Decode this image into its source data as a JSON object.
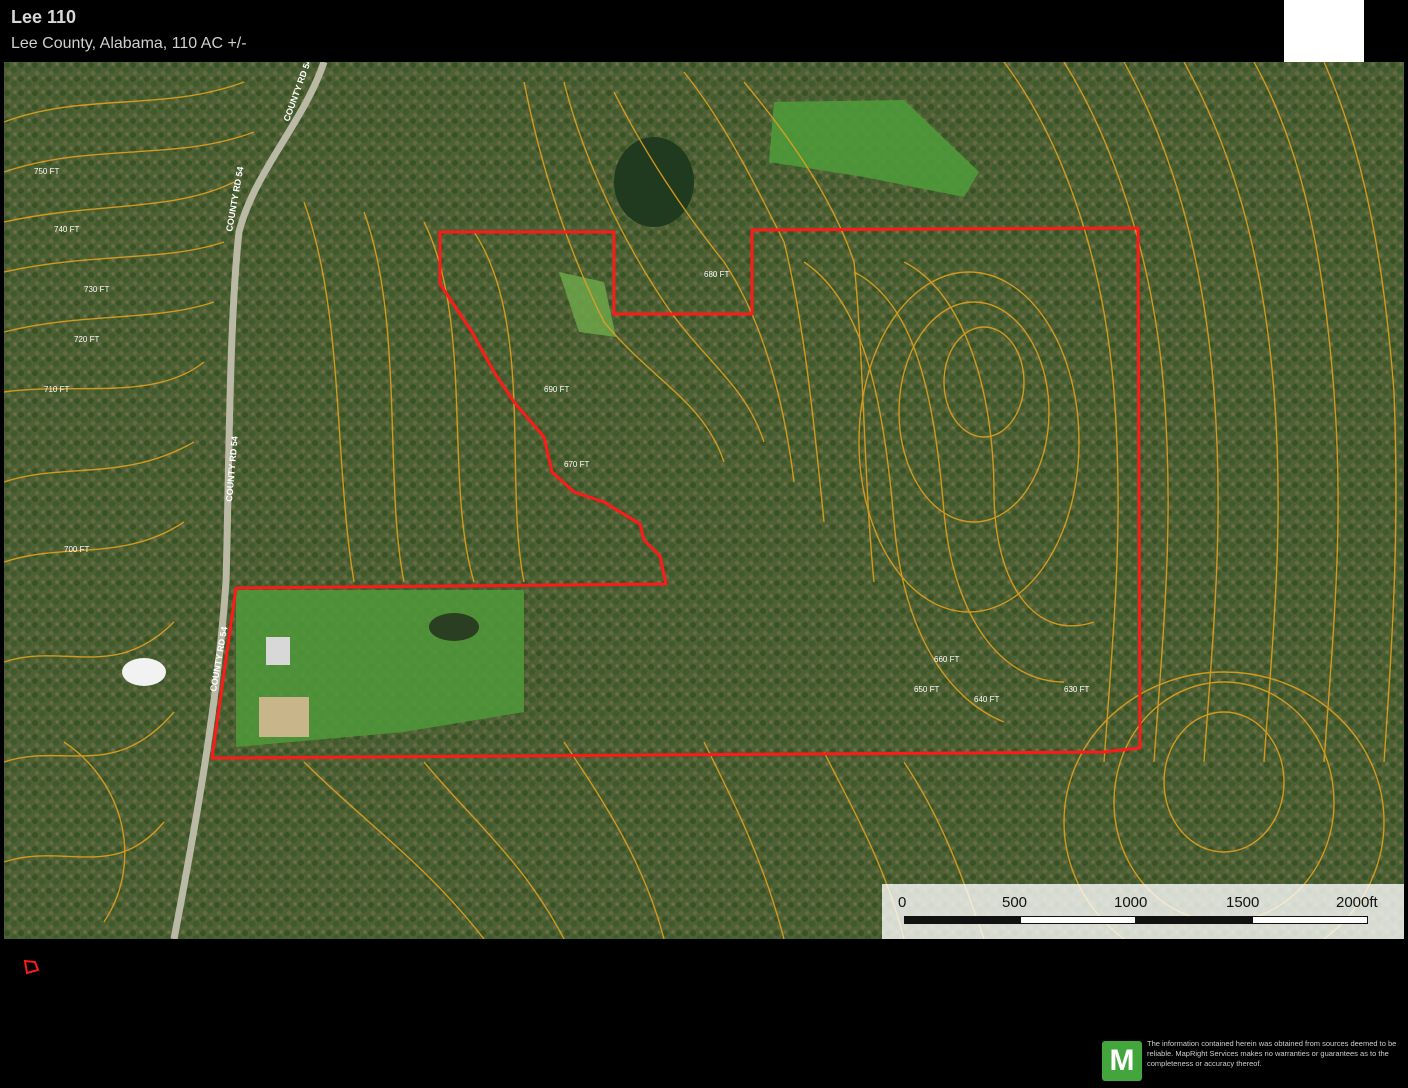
{
  "header": {
    "title": "Lee 110",
    "subtitle": "Lee County, Alabama, 110 AC +/-"
  },
  "map": {
    "road_labels": [
      "COUNTY RD 54",
      "COUNTY RD 54",
      "COUNTY RD 54",
      "COUNTY RD 54"
    ],
    "contour_labels": [
      "750 FT",
      "740 FT",
      "730 FT",
      "720 FT",
      "710 FT",
      "700 FT",
      "690 FT",
      "680 FT",
      "670 FT",
      "660 FT",
      "650 FT",
      "640 FT",
      "630 FT"
    ],
    "colors": {
      "boundary": "#ff1a1a",
      "contour": "#e0a020",
      "forest": "#3f5a2c",
      "field": "#4f9a3a"
    }
  },
  "scale": {
    "labels": [
      "0",
      "500",
      "1000",
      "1500",
      "2000ft"
    ]
  },
  "footer": {
    "logo_letter": "M",
    "disclaimer": "The information contained herein was obtained from sources deemed to be reliable. MapRight Services makes no warranties or guarantees as to the completeness or accuracy thereof."
  }
}
